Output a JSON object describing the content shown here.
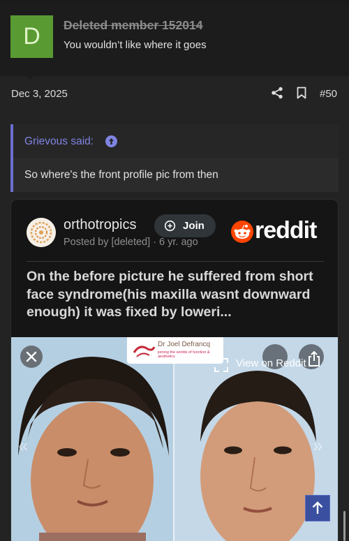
{
  "member": {
    "avatar_letter": "D",
    "username": "Deleted member 152014",
    "user_title": "You wouldn’t like where it goes"
  },
  "post": {
    "date": "Dec 3, 2025",
    "number": "#50"
  },
  "quote": {
    "author": "Grievous said:",
    "text": "So where's the front profile pic from then"
  },
  "embed": {
    "subreddit": "orthotropics",
    "join_label": "Join",
    "posted": "Posted by [deleted] · 6 yr. ago",
    "brand": "reddit",
    "headline": "On the before picture he suffered from short face syndrome(his maxilla wasnt downward enough) it was fixed by loweri...",
    "watermark_name": "Dr Joel Defrancq",
    "watermark_sub": "joining the worlds of function & aesthetics",
    "view_label": "View on Reddit"
  },
  "colors": {
    "avatar": "#5a9a32",
    "quote_accent": "#6b6fd0",
    "reddit_orange": "#ff4500",
    "scroll_top_button": "#3b4fa0"
  }
}
